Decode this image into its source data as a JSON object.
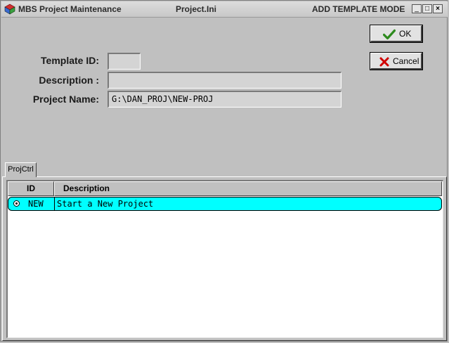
{
  "window": {
    "app_title": "MBS Project Maintenance",
    "file_name": "Project.Ini",
    "mode": "ADD TEMPLATE MODE",
    "controls": {
      "minimize": "_",
      "maximize": "□",
      "close": "×"
    }
  },
  "form": {
    "template_id_label": "Template ID:",
    "template_id_value": "",
    "description_label": "Description :",
    "description_value": "",
    "project_name_label": "Project Name:",
    "project_name_value": "G:\\DAN_PROJ\\NEW-PROJ"
  },
  "buttons": {
    "ok_label": "OK",
    "ok_icon": "checkmark-icon",
    "cancel_label": "Cancel",
    "cancel_icon": "x-icon"
  },
  "tabs": [
    {
      "label": "ProjCtrl",
      "selected": true
    }
  ],
  "table": {
    "columns": [
      "ID",
      "Description"
    ],
    "rows": [
      {
        "id": "NEW",
        "description": "Start a New Project",
        "selected": true
      }
    ]
  },
  "colors": {
    "selected_row": "#00ffff",
    "ok_check": "#2e8b1e",
    "cancel_x": "#d00000"
  }
}
